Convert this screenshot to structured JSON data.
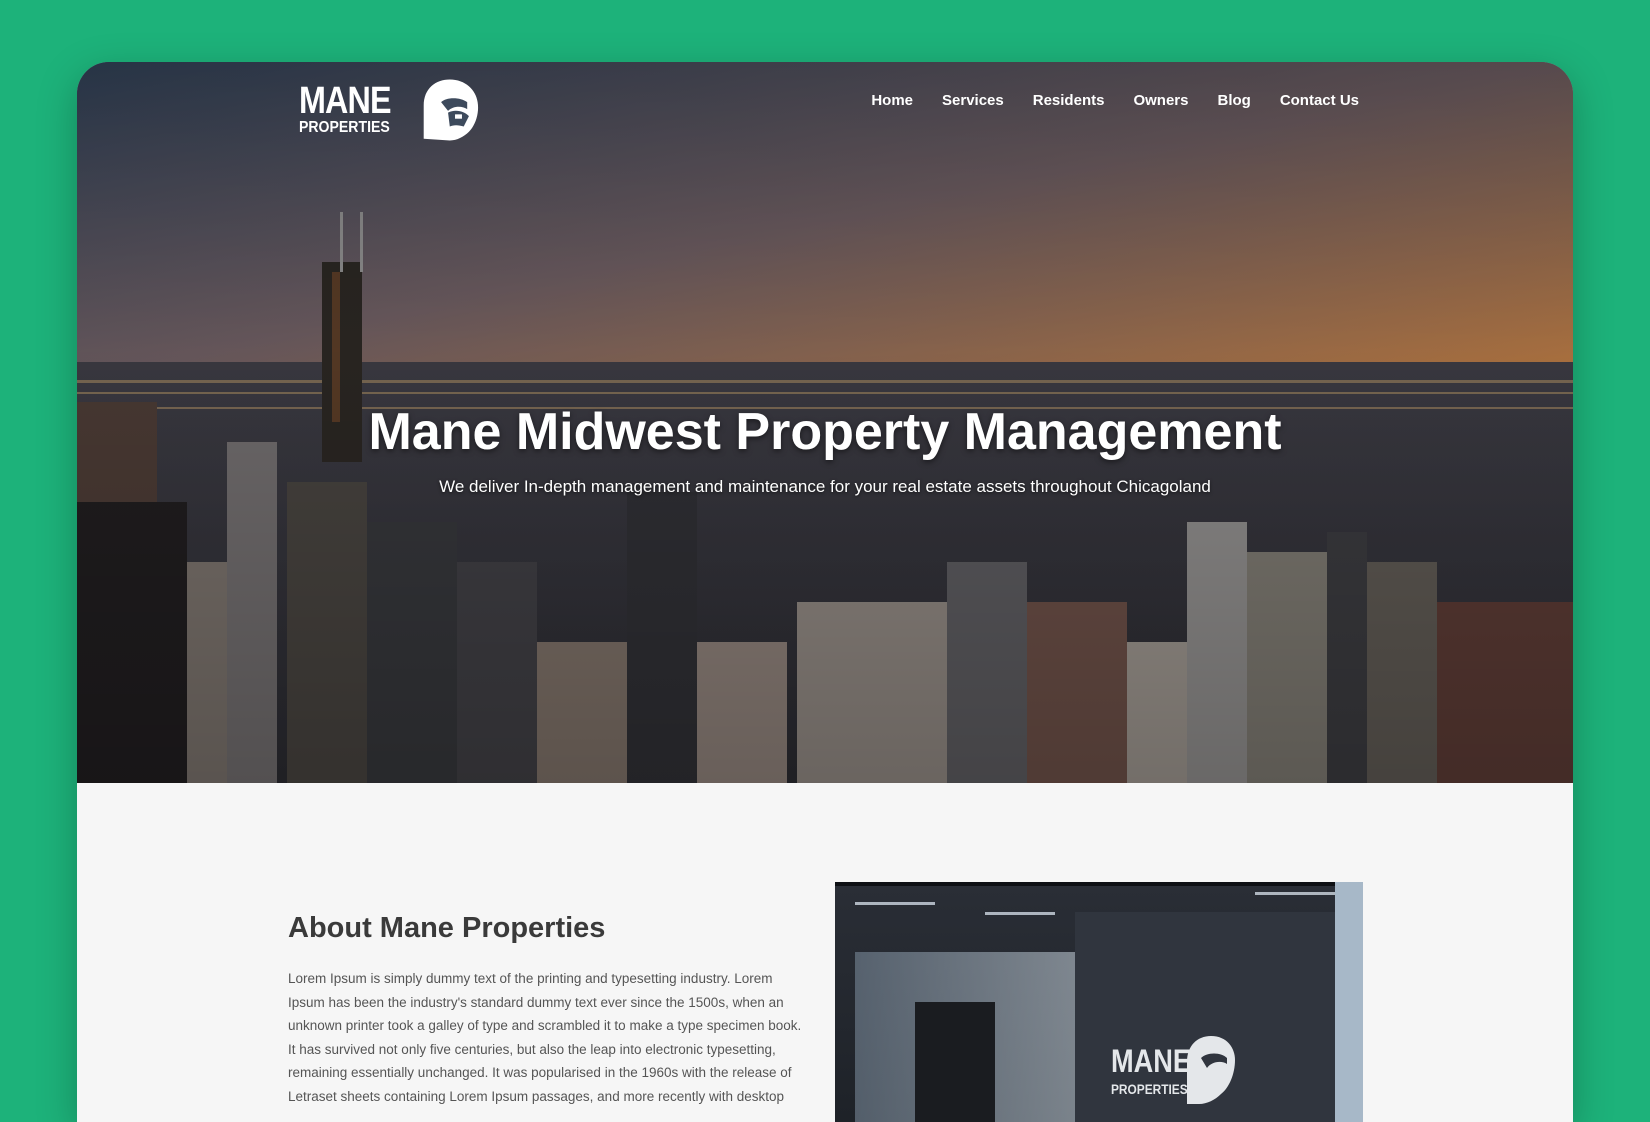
{
  "brand": {
    "name": "MANE",
    "sub": "PROPERTIES"
  },
  "nav": {
    "items": [
      {
        "label": "Home"
      },
      {
        "label": "Services"
      },
      {
        "label": "Residents"
      },
      {
        "label": "Owners"
      },
      {
        "label": "Blog"
      },
      {
        "label": "Contact Us"
      }
    ]
  },
  "hero": {
    "title": "Mane Midwest Property Management",
    "subtitle": "We deliver In-depth management and maintenance for your real estate assets throughout Chicagoland"
  },
  "about": {
    "title": "About Mane Properties",
    "body": "Lorem Ipsum is simply dummy text of the printing and typesetting industry. Lorem Ipsum has been the industry's standard dummy text ever since the 1500s, when an unknown printer took a galley of type and scrambled it to make a type specimen book. It has survived not only five centuries, but also the leap into electronic typesetting, remaining essentially unchanged. It was popularised in the 1960s with the release of Letraset sheets containing Lorem Ipsum passages, and more recently with desktop",
    "image_sign": {
      "name": "MANE",
      "sub": "PROPERTIES"
    }
  },
  "colors": {
    "background": "#1db27a",
    "page": "#f6f6f6",
    "text_dark": "#3a3a3a"
  }
}
